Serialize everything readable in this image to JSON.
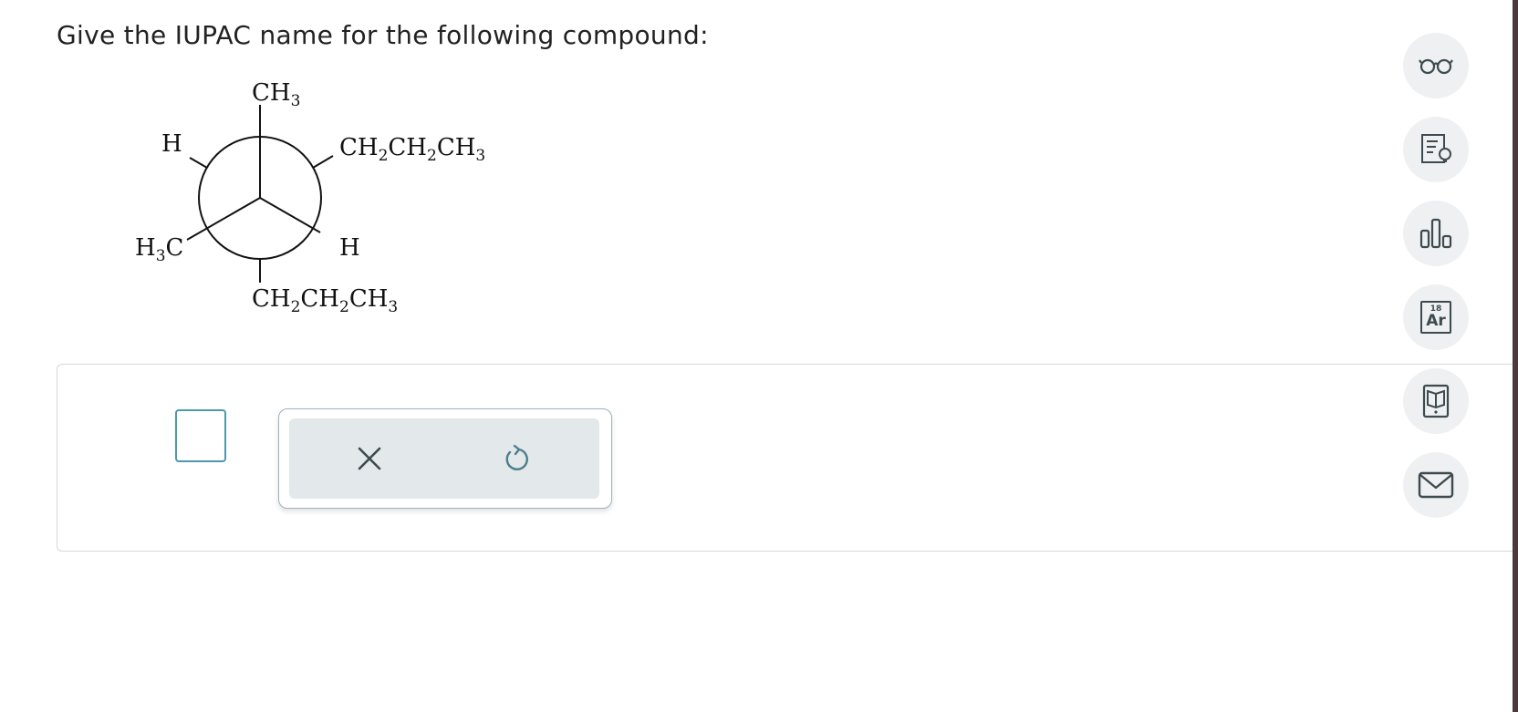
{
  "question": {
    "text": "Give the IUPAC name for the following compound:"
  },
  "structure": {
    "front_top": "CH3",
    "front_left_bottom": "H3C",
    "back_left_top": "H",
    "back_right_top": "CH2CH2CH3",
    "back_right_bottom": "H",
    "back_bottom": "CH2CH2CH3"
  },
  "answer": {
    "value": ""
  },
  "tools": {
    "clear_icon": "close-icon",
    "undo_icon": "undo-icon"
  },
  "sidebar": {
    "items": [
      {
        "icon": "glasses-icon"
      },
      {
        "icon": "hint-icon"
      },
      {
        "icon": "bar-chart-icon"
      },
      {
        "icon": "periodic-table-icon",
        "number": "18",
        "symbol": "Ar"
      },
      {
        "icon": "textbook-icon"
      },
      {
        "icon": "mail-icon"
      }
    ]
  },
  "colors": {
    "accent": "#4a9aa8",
    "icon": "#3d4a50",
    "panel_border": "#d3dadd",
    "tool_bg": "#e3e8ea"
  }
}
